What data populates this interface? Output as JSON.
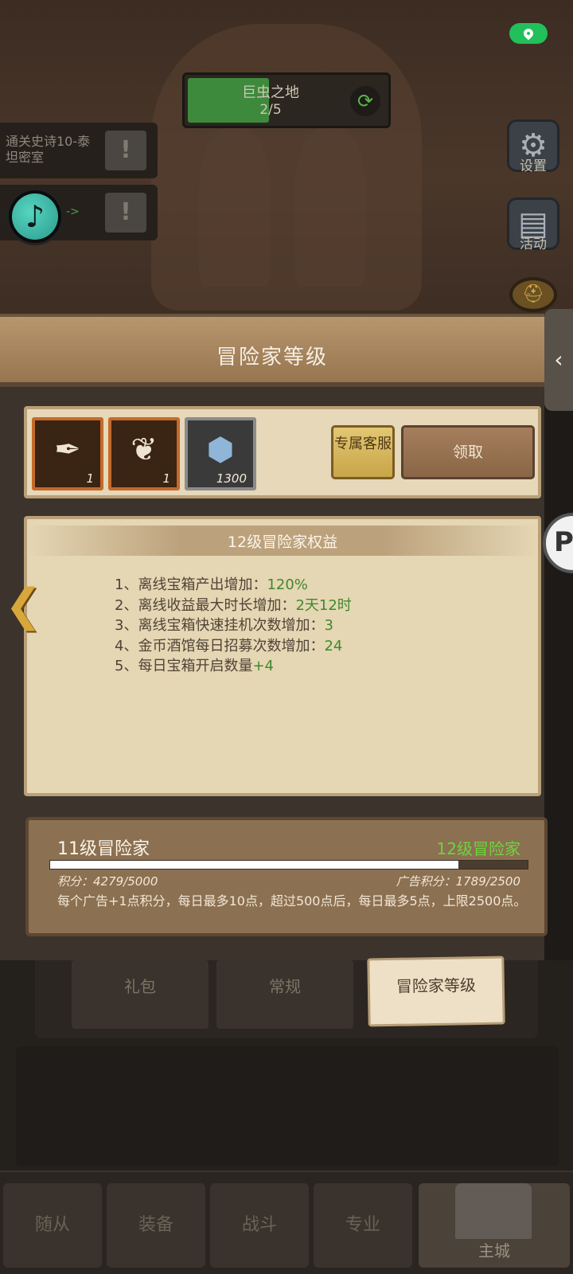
{
  "scene": {
    "stage": {
      "name": "巨虫之地",
      "progress": "2/5",
      "fill_fraction": 0.4
    },
    "quests": [
      {
        "text": "通关史诗10-泰坦密室",
        "button": "!"
      },
      {
        "text": "",
        "arrow": "->",
        "button": "!"
      }
    ],
    "side_icons": [
      {
        "label": "设置",
        "icon": "gear-icon"
      },
      {
        "label": "活动",
        "icon": "scroll-icon"
      }
    ],
    "side_tab_glyph": "‹"
  },
  "panel": {
    "title": "冒险家等级",
    "rewards": [
      {
        "icon": "scroll-feather-icon",
        "count": "1"
      },
      {
        "icon": "wing-armor-icon",
        "count": "1"
      },
      {
        "icon": "gem-icon",
        "count": "1300"
      }
    ],
    "support_button": "专属客服",
    "claim_button": "领取",
    "benefits": {
      "title": "12级冒险家权益",
      "items": [
        {
          "label": "1、离线宝箱产出增加：",
          "value": "120%"
        },
        {
          "label": "2、离线收益最大时长增加：",
          "value": "2天12时"
        },
        {
          "label": "3、离线宝箱快速挂机次数增加：",
          "value": "3"
        },
        {
          "label": "4、金币酒馆每日招募次数增加：",
          "value": "24"
        },
        {
          "label": "5、每日宝箱开启数量",
          "value": "+4"
        }
      ]
    },
    "level": {
      "current": "11级冒险家",
      "next": "12级冒险家",
      "progress_fraction": 0.855,
      "score": "积分：4279/5000",
      "ad_score": "广告积分：1789/2500",
      "description": "每个广告+1点积分，每日最多10点，超过500点后，每日最多5点，上限2500点。"
    }
  },
  "lower": {
    "tabs": [
      "礼包",
      "常规",
      "冒险家等级"
    ],
    "active_tab": 2
  },
  "nav": {
    "items": [
      "随从",
      "装备",
      "战斗",
      "专业",
      "主城"
    ],
    "active": 4
  },
  "colors": {
    "accent_green": "#3f8a2b",
    "next_level_green": "#6dd43d",
    "panel_wood": "#a5845e",
    "parchment": "#e5d6b4"
  }
}
